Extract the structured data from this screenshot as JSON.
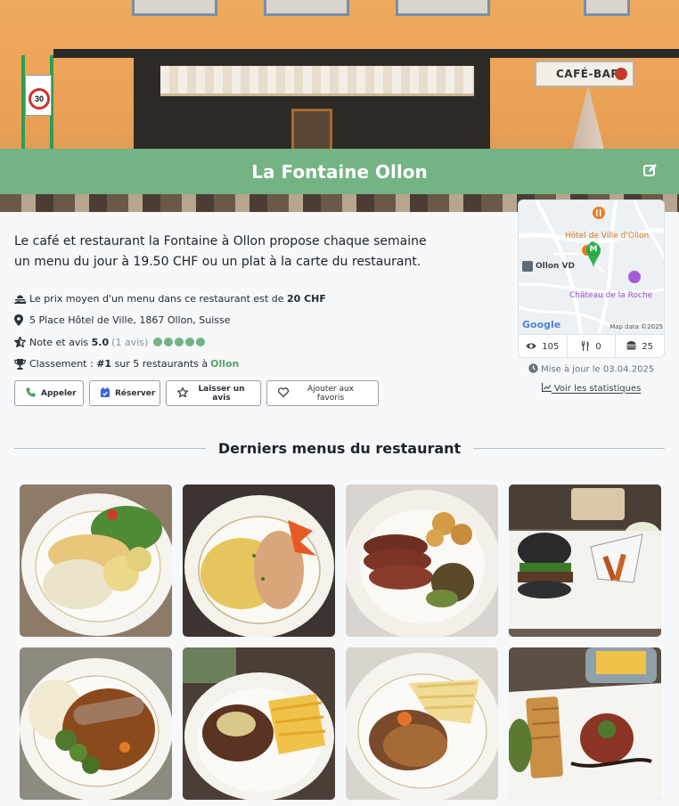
{
  "restaurant": {
    "name": "La Fontaine Ollon",
    "description": "Le café et restaurant la Fontaine à Ollon propose chaque semaine un menu du jour à 19.50 CHF ou un plat à la carte du restaurant.",
    "price_prefix": "Le prix moyen d'un menu dans ce restaurant est de",
    "price_value": "20 CHF",
    "address": "5 Place Hôtel de Ville, 1867 Ollon, Suisse",
    "rating_prefix": "Note et avis",
    "rating_value": "5.0",
    "rating_count": "(1 avis)",
    "rating_stars": 5,
    "rank_prefix": "Classement :",
    "rank_value": "#1",
    "rank_middle": "sur 5 restaurants à",
    "rank_city": "Ollon"
  },
  "hero_signs": {
    "cafe_bar": "CAFÉ-BAR",
    "zone": "30"
  },
  "actions": {
    "call": "Appeler",
    "book": "Réserver",
    "review": "Laisser un avis",
    "favorite": "Ajouter aux favoris"
  },
  "map": {
    "label_townhall": "Hôtel de Ville d'Ollon",
    "label_ollon": "Ollon VD",
    "label_castle": "Château de la Roche",
    "marker_letter": "M",
    "google": "Google",
    "credit": "Map data ©2025"
  },
  "stats": {
    "views": "105",
    "menus": "0",
    "dishes": "25"
  },
  "updated": {
    "prefix": "Mise à jour le",
    "date": "03.04.2025"
  },
  "stats_link": "Voir les statistiques",
  "section": {
    "title": "Derniers menus du restaurant"
  },
  "icons": {
    "edit": "edit-icon",
    "price": "serving-hand-icon",
    "address": "map-marker-icon",
    "rating": "star-half-icon",
    "rank": "trophy-icon",
    "call": "phone-icon",
    "book": "calendar-icon",
    "review": "star-outline-icon",
    "favorite": "heart-icon",
    "views": "eye-icon",
    "menus": "utensils-icon",
    "dishes": "burger-icon",
    "clock": "clock-icon",
    "chart": "chart-line-icon"
  },
  "colors": {
    "accent": "#73b384",
    "accent_text": "#5a9e6b"
  }
}
